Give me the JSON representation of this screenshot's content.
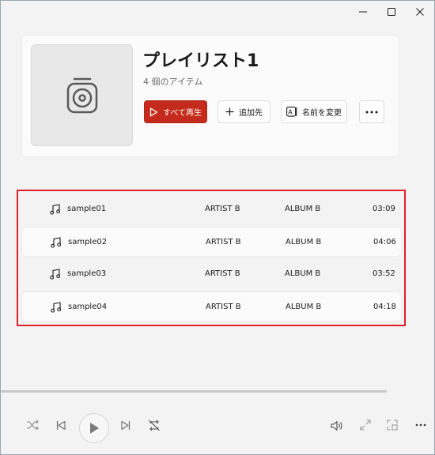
{
  "window": {
    "controls": [
      "minimize",
      "maximize",
      "close"
    ]
  },
  "playlist": {
    "title": "プレイリスト1",
    "item_count_text": "4 個のアイテム",
    "actions": {
      "play_all": "すべて再生",
      "add_to": "追加先",
      "rename": "名前を変更"
    }
  },
  "tracks": [
    {
      "title": "sample01",
      "artist": "ARTIST B",
      "album": "ALBUM B",
      "duration": "03:09"
    },
    {
      "title": "sample02",
      "artist": "ARTIST B",
      "album": "ALBUM B",
      "duration": "04:06"
    },
    {
      "title": "sample03",
      "artist": "ARTIST B",
      "album": "ALBUM B",
      "duration": "03:52"
    },
    {
      "title": "sample04",
      "artist": "ARTIST B",
      "album": "ALBUM B",
      "duration": "04:18"
    }
  ],
  "player": {
    "progress_fraction": 0.89,
    "buttons": [
      "shuffle",
      "previous",
      "play",
      "next",
      "repeat",
      "volume",
      "fullscreen",
      "mini-player",
      "more"
    ]
  },
  "colors": {
    "accent": "#c42b1c",
    "highlight_border": "#e0202d",
    "background": "#f3f3f3"
  }
}
